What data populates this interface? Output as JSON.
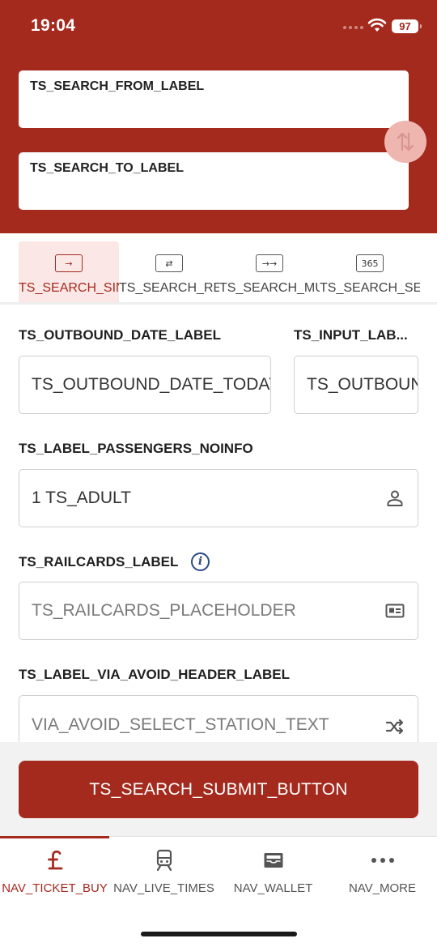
{
  "status_bar": {
    "time": "19:04",
    "battery": "97"
  },
  "search": {
    "from_label": "TS_SEARCH_FROM_LABEL",
    "to_label": "TS_SEARCH_TO_LABEL"
  },
  "tabs": [
    {
      "label": "TS_SEARCH_SINGLE",
      "icon": "single-arrow-icon",
      "glyph": "→",
      "active": true
    },
    {
      "label": "TS_SEARCH_RETURN",
      "icon": "return-arrows-icon",
      "glyph": "⇄",
      "active": false
    },
    {
      "label": "TS_SEARCH_MULTI",
      "icon": "multi-arrow-icon",
      "glyph": "→→",
      "active": false
    },
    {
      "label": "TS_SEARCH_SEASON",
      "icon": "calendar-365-icon",
      "glyph": "365",
      "active": false
    }
  ],
  "outbound": {
    "date_label": "TS_OUTBOUND_DATE_LABEL",
    "date_value": "TS_OUTBOUND_DATE_TODAY",
    "time_label": "TS_INPUT_LAB...",
    "time_value": "TS_OUTBOUND_TIME"
  },
  "passengers": {
    "label": "TS_LABEL_PASSENGERS_NOINFO",
    "value": "1 TS_ADULT"
  },
  "railcards": {
    "label": "TS_RAILCARDS_LABEL",
    "placeholder": "TS_RAILCARDS_PLACEHOLDER"
  },
  "via_avoid": {
    "label": "TS_LABEL_VIA_AVOID_HEADER_LABEL",
    "placeholder": "VIA_AVOID_SELECT_STATION_TEXT"
  },
  "submit_label": "TS_SEARCH_SUBMIT_BUTTON",
  "nav": [
    {
      "label": "NAV_TICKET_BUY",
      "icon": "pound-icon",
      "active": true
    },
    {
      "label": "NAV_LIVE_TIMES",
      "icon": "train-icon",
      "active": false
    },
    {
      "label": "NAV_WALLET",
      "icon": "wallet-icon",
      "active": false
    },
    {
      "label": "NAV_MORE",
      "icon": "more-dots-icon",
      "active": false
    }
  ],
  "colors": {
    "brand": "#a42a1e",
    "swap_button": "#efb6b0",
    "info_icon": "#2c4a8a"
  }
}
